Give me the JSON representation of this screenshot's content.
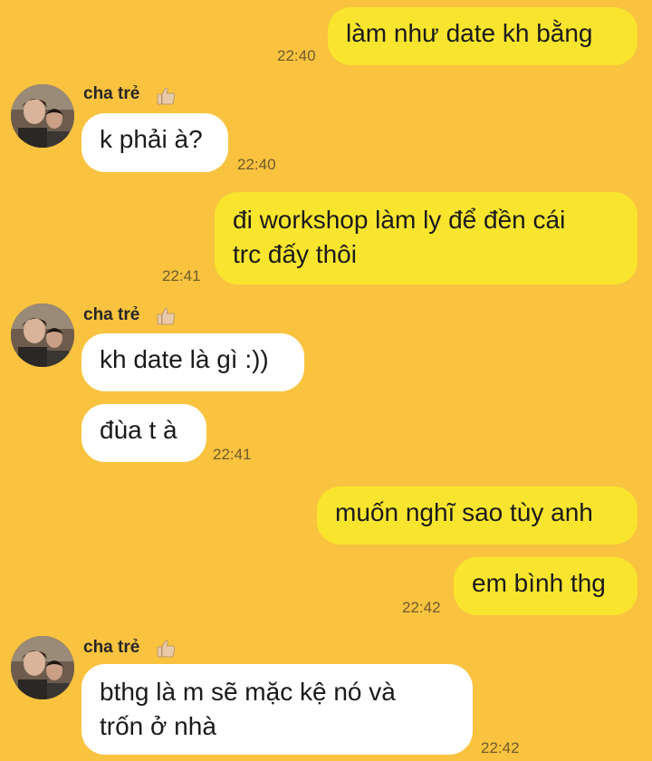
{
  "contact": {
    "name": "cha trẻ"
  },
  "messages": [
    {
      "from": "me",
      "text": "làm như date kh bằng",
      "time": "22:40"
    },
    {
      "from": "contact",
      "text": "k phải à?",
      "time": "22:40"
    },
    {
      "from": "me",
      "lines": [
        "đi workshop làm ly để đền cái",
        "trc đấy thôi"
      ],
      "time": "22:41"
    },
    {
      "from": "contact",
      "text": "kh date là gì :))"
    },
    {
      "from": "contact",
      "text": "đùa t à",
      "time": "22:41"
    },
    {
      "from": "me",
      "text": "muốn nghĩ sao tùy anh"
    },
    {
      "from": "me",
      "text": "em bình thg",
      "time": "22:42"
    },
    {
      "from": "contact",
      "lines": [
        "bthg là m sẽ mặc kệ nó và",
        "trốn ở nhà"
      ],
      "time": "22:42"
    }
  ],
  "colors": {
    "background": "#f9c33f",
    "sent_bubble": "#fae52e",
    "received_bubble": "#ffffff"
  },
  "icons": {
    "avatar": "avatar",
    "sender_badge": "thumbs-up-icon"
  }
}
